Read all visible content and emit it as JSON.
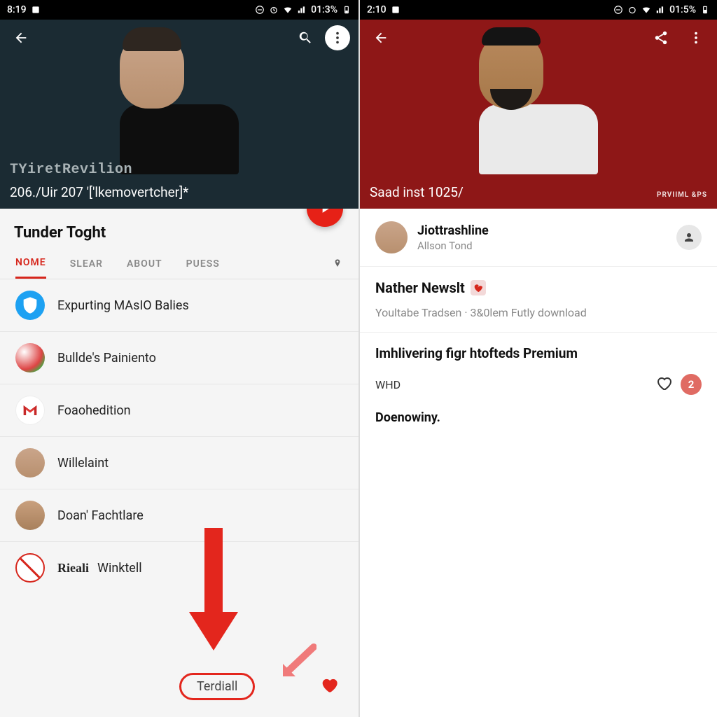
{
  "left": {
    "status": {
      "time": "8:19",
      "battery": "01:3%"
    },
    "hero": {
      "watermark": "TYiretRevilion",
      "subtitle": "206./Uir 207 '['lkemovertcher]*"
    },
    "channel_title": "Tunder Toght",
    "tabs": [
      {
        "label": "NOME",
        "active": true
      },
      {
        "label": "SLEAR",
        "active": false
      },
      {
        "label": "ABOUT",
        "active": false
      },
      {
        "label": "PUESS",
        "active": false
      }
    ],
    "list": [
      {
        "label": "Expurting MAsIO Balies",
        "avatar": "shield-blue"
      },
      {
        "label": "Bullde's Painiento",
        "avatar": "misc"
      },
      {
        "label": "Foaohedition",
        "avatar": "gmail"
      },
      {
        "label": "Willelaint",
        "avatar": "person"
      },
      {
        "label": "Doan' Fachtlare",
        "avatar": "person"
      },
      {
        "label": "Winktell",
        "avatar": "noentry",
        "prefix": "Rieali"
      }
    ],
    "callout_label": "Terdiall"
  },
  "right": {
    "status": {
      "time": "2:10",
      "battery": "01:5%"
    },
    "hero": {
      "subtitle": "Saad inst 1025/",
      "badge": "PRVIIML &PS"
    },
    "channel": {
      "name": "Jiottrashline",
      "sub": "Allson Tond"
    },
    "section": {
      "title": "Nather Newslt",
      "subtitle": "Youltabe Tradsen · 3&0lem Futly download"
    },
    "premium": {
      "title": "Imhlivering figr htofteds Premium",
      "line_label": "WHD",
      "badge_count": "2",
      "final": "Doenowiny."
    }
  },
  "icons": {
    "back": "back-icon",
    "search": "search-icon",
    "more": "more-icon",
    "share": "share-icon",
    "play": "play-icon",
    "pin": "pin-icon",
    "person": "person-icon",
    "heart": "heart-icon",
    "shield": "shield-icon",
    "broken_heart": "broken-heart-icon"
  }
}
